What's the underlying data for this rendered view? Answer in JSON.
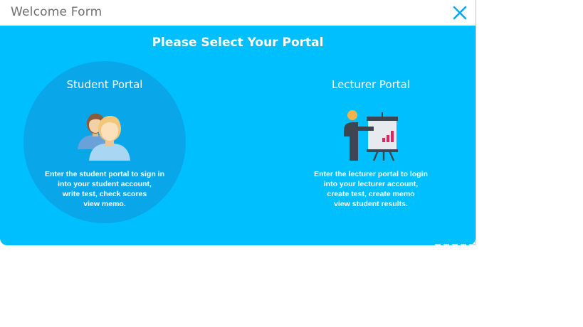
{
  "window": {
    "title": "Welcome Form",
    "close_icon": "close-icon"
  },
  "colors": {
    "panel_background": "#00bfff",
    "student_circle": "#0aa6ea",
    "close_icon": "#0aa6ea",
    "text": "#ffffff"
  },
  "main": {
    "heading": "Please Select Your Portal"
  },
  "student_portal": {
    "title": "Student Portal",
    "icon": "students-icon",
    "description": [
      "Enter the student portal to sign in",
      "into your student account,",
      "write test, check scores",
      "view memo."
    ]
  },
  "lecturer_portal": {
    "title": "Lecturer Portal",
    "icon": "lecturer-presentation-icon",
    "description": [
      "Enter the lecturer portal to login",
      "into your lecturer account,",
      "create test, create memo",
      "view student results."
    ]
  }
}
